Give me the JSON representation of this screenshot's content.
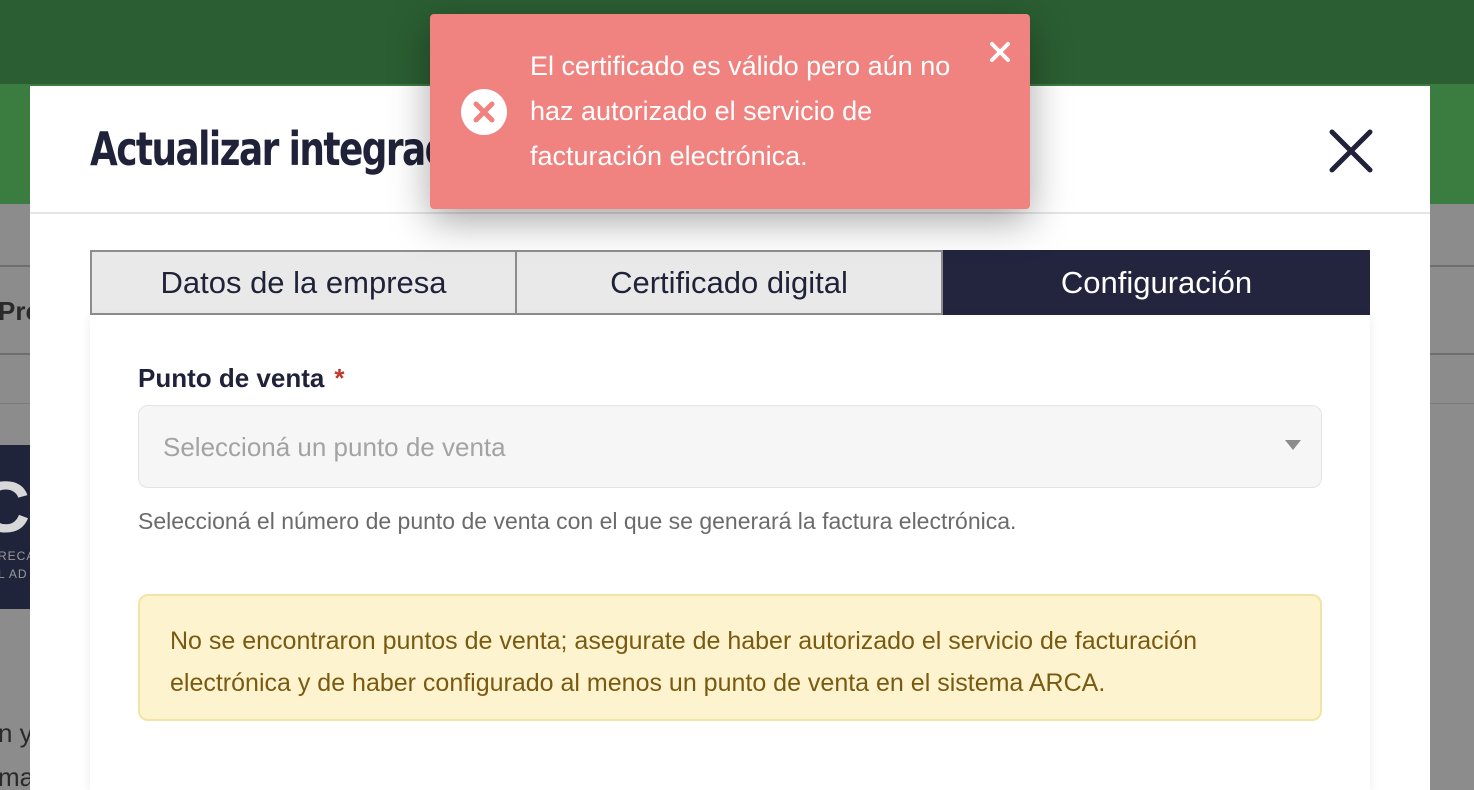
{
  "background": {
    "heading_fragment": "Pro",
    "card_fragment_1": "RECA",
    "card_fragment_2": "L AD",
    "body_fragment_1": "n y",
    "body_fragment_2": "ma"
  },
  "modal": {
    "title": "Actualizar integración",
    "close_icon": "close-icon"
  },
  "tabs": [
    {
      "label": "Datos de la empresa",
      "active": false
    },
    {
      "label": "Certificado digital",
      "active": false
    },
    {
      "label": "Configuración",
      "active": true
    }
  ],
  "form": {
    "punto_de_venta": {
      "label": "Punto de venta",
      "required_mark": "*",
      "placeholder": "Seleccioná un punto de venta",
      "help": "Seleccioná el número de punto de venta con el que se generará la factura electrónica."
    },
    "warning": "No se encontraron puntos de venta; asegurate de haber autorizado el servicio de facturación electrónica y de haber configurado al menos un punto de venta en el sistema ARCA."
  },
  "toast": {
    "message": "El certificado es válido pero aún no haz autorizado el servicio de facturación electrónica.",
    "icon": "error-circle-icon",
    "close_icon": "close-icon"
  },
  "colors": {
    "topbar": "#2b5e32",
    "green_band": "#3b7c41",
    "navy": "#22253d",
    "toast_bg": "#f08380",
    "warning_bg": "#fdf4cf",
    "warning_text": "#7a5a10",
    "required": "#c0392b"
  }
}
